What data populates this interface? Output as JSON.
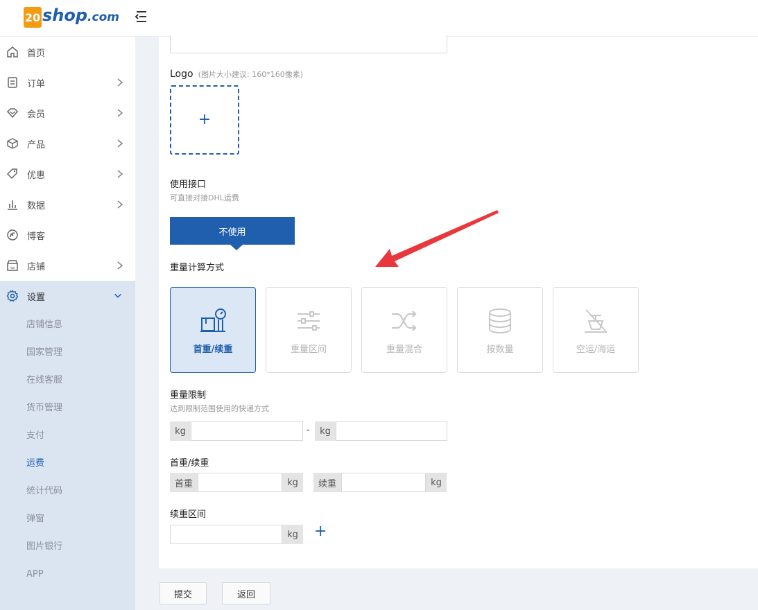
{
  "header": {
    "logo_badge": "20",
    "logo_main": "shop",
    "logo_suffix": ".com"
  },
  "sidebar": {
    "items": [
      {
        "label": "首页",
        "icon": "home-icon"
      },
      {
        "label": "订单",
        "icon": "order-icon"
      },
      {
        "label": "会员",
        "icon": "member-icon"
      },
      {
        "label": "产品",
        "icon": "product-icon"
      },
      {
        "label": "优惠",
        "icon": "tag-icon"
      },
      {
        "label": "数据",
        "icon": "chart-icon"
      },
      {
        "label": "博客",
        "icon": "blog-icon"
      },
      {
        "label": "店铺",
        "icon": "store-icon"
      },
      {
        "label": "设置",
        "icon": "gear-icon"
      }
    ],
    "settings_sub": [
      "店铺信息",
      "国家管理",
      "在线客服",
      "货币管理",
      "支付",
      "运费",
      "统计代码",
      "弹窗",
      "图片银行",
      "APP"
    ],
    "current_sub": "运费"
  },
  "form": {
    "logo_label": "Logo",
    "logo_hint": "(图片大小建议: 160*160像素)",
    "logo_upload_plus": "+",
    "api_label": "使用接口",
    "api_hint": "可直接对接DHL运费",
    "api_button": "不使用",
    "calc_label": "重量计算方式",
    "methods": [
      {
        "label": "首重/续重",
        "icon": "scale-box-icon",
        "selected": true
      },
      {
        "label": "重量区间",
        "icon": "sliders-icon",
        "selected": false
      },
      {
        "label": "重量混合",
        "icon": "shuffle-icon",
        "selected": false
      },
      {
        "label": "按数量",
        "icon": "database-icon",
        "selected": false
      },
      {
        "label": "空运/海运",
        "icon": "ship-icon",
        "selected": false
      }
    ],
    "limit_label": "重量限制",
    "limit_hint": "达到限制范围使用的快递方式",
    "limit_unit_min": "kg",
    "limit_dash": "-",
    "limit_unit_max": "kg",
    "first_cont_label": "首重/续重",
    "first_weight_prefix": "首重",
    "first_weight_unit": "kg",
    "cont_weight_prefix": "续重",
    "cont_weight_unit": "kg",
    "cont_range_label": "续重区间",
    "cont_range_unit": "kg",
    "cont_range_add": "+"
  },
  "footer": {
    "submit": "提交",
    "back": "返回"
  },
  "colors": {
    "brand_blue": "#1f5fae",
    "brand_orange": "#f39c12",
    "arrow_red": "#e8383d"
  }
}
